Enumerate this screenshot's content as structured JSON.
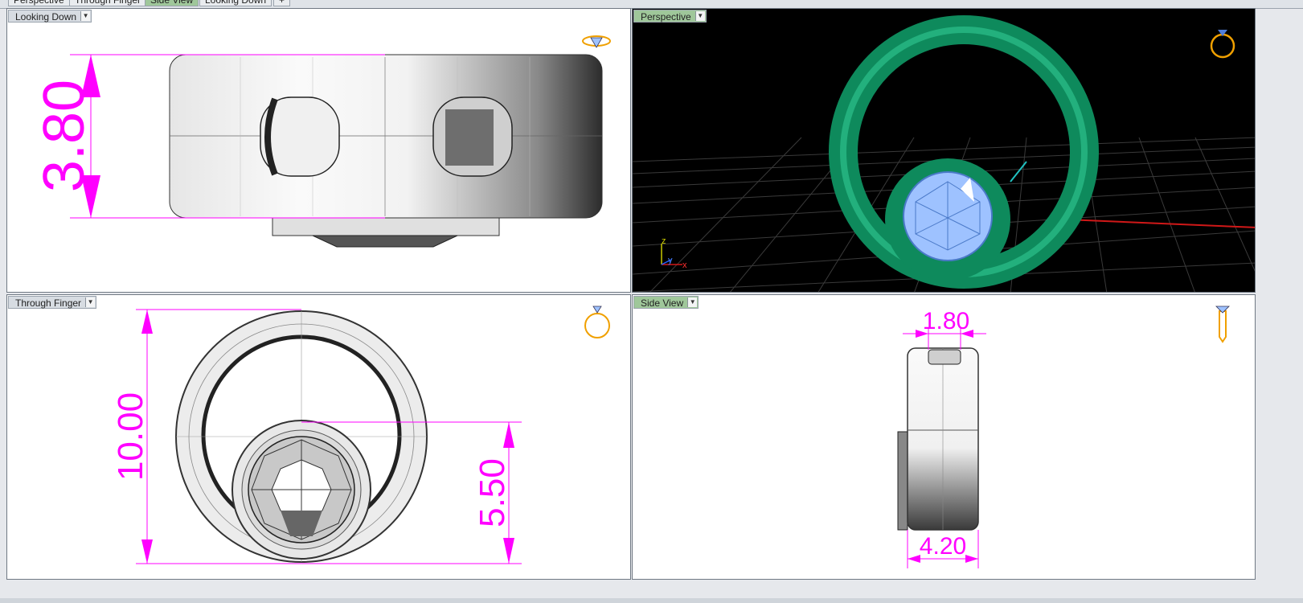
{
  "tabs": [
    {
      "label": "Perspective",
      "active": false
    },
    {
      "label": "Through Finger",
      "active": false
    },
    {
      "label": "Side View",
      "active": true
    },
    {
      "label": "Looking Down",
      "active": false
    }
  ],
  "tab_add_label": "+",
  "viewports": {
    "looking_down": {
      "label": "Looking Down",
      "dimension": "3.80"
    },
    "perspective": {
      "label": "Perspective",
      "axis_z": "z",
      "axis_y": "y",
      "axis_x": "x"
    },
    "through_finger": {
      "label": "Through Finger",
      "dimension_outer": "10.00",
      "dimension_stone": "5.50"
    },
    "side_view": {
      "label": "Side View",
      "dimension_top": "1.80",
      "dimension_bottom": "4.20"
    }
  },
  "colors": {
    "dimension": "#ff00ff",
    "ring_green": "#0e8a5c",
    "stone_blue": "#9ec2ff",
    "gizmo_orange": "#f0a000",
    "active_tab": "#9fc79a"
  },
  "icons": {
    "viewport_menu": "chevron-down-icon",
    "gizmo": "ring-gizmo-icon"
  }
}
